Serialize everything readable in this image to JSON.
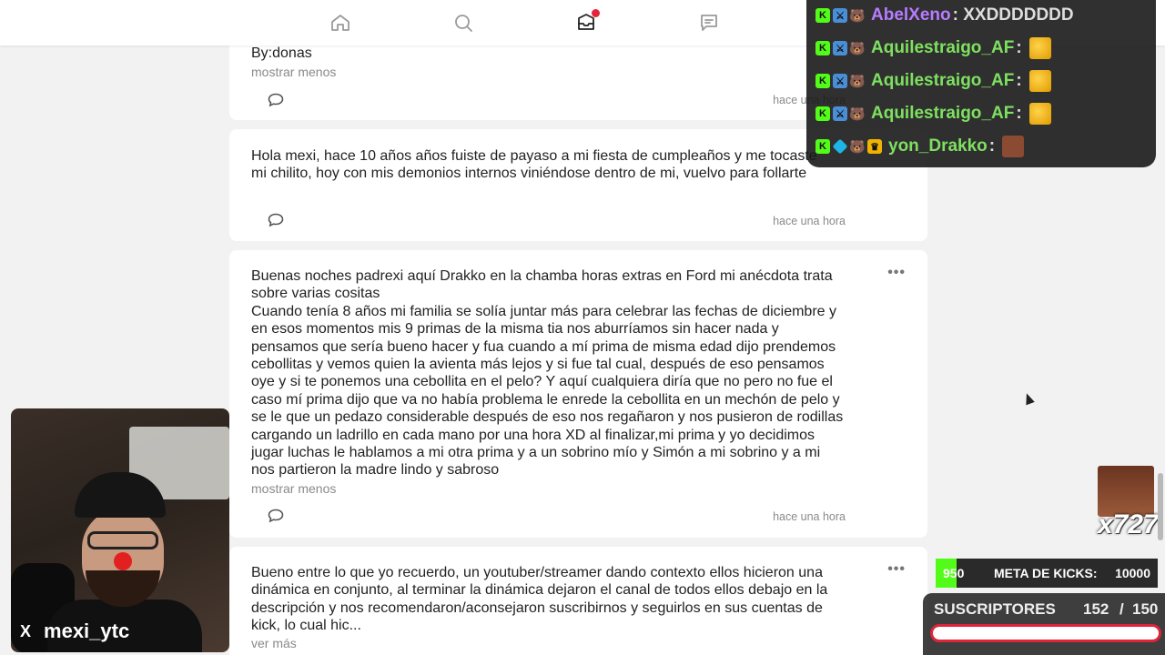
{
  "nav": {
    "icons": [
      "home-icon",
      "search-icon",
      "inbox-icon",
      "messages-icon"
    ]
  },
  "posts": [
    {
      "text": "By:donas",
      "toggle": "mostrar menos",
      "time": "hace una hora"
    },
    {
      "text": "Hola mexi, hace 10 años años fuiste de payaso a mi fiesta de cumpleaños y me tocaste mi chilito, hoy con mis demonios internos viniéndose dentro de mi, vuelvo para follarte",
      "time": "hace una hora"
    },
    {
      "text": "Buenas noches padrexi aquí Drakko en la chamba horas extras en Ford mi anécdota trata sobre varias cositas\nCuando tenía 8 años mi familia se solía juntar más para celebrar las fechas de diciembre y en esos momentos mis 9 primas de la misma tia nos aburríamos sin hacer nada y pensamos que sería bueno hacer y fua cuando a mí prima de misma edad dijo prendemos cebollitas y vemos quien la avienta más lejos y si fue tal cual, después de eso pensamos oye y si te ponemos una cebollita en el pelo? Y aquí cualquiera diría que no pero no fue el caso mí prima dijo que va no había problema le enrede la cebollita en un mechón de pelo y se le que un pedazo considerable después de eso nos regañaron y nos pusieron de rodillas cargando un ladrillo en cada mano por una hora XD al finalizar,mi prima y yo decidimos jugar luchas le hablamos a mi otra prima y a un sobrino mío y Simón a mi sobrino y a mi nos partieron la madre lindo y sabroso",
      "toggle": "mostrar menos",
      "time": "hace una hora",
      "more": "•••"
    },
    {
      "text": "Bueno entre lo que yo recuerdo, un youtuber/streamer dando contexto ellos hicieron una dinámica en conjunto, al terminar la dinámica dejaron el canal de todos ellos debajo en la descripción y nos recomendaron/aconsejaron suscribirnos y seguirlos en sus cuentas de kick, lo cual hic...",
      "toggle": "ver más",
      "more": "•••"
    }
  ],
  "chat": [
    {
      "user": "AbelXeno",
      "msg": ": XXDDDDDDD",
      "color": "#b67cff"
    },
    {
      "user": "Aquilestraigo_AF",
      "msg": ":",
      "color": "#7ee060"
    },
    {
      "user": "Aquilestraigo_AF",
      "msg": ":",
      "color": "#7ee060"
    },
    {
      "user": "Aquilestraigo_AF",
      "msg": ":",
      "color": "#7ee060"
    },
    {
      "user": "yon_Drakko",
      "msg": ":",
      "color": "#7ee060"
    }
  ],
  "webcam": {
    "handle": "mexi_ytc",
    "x_label": "X"
  },
  "widgets": {
    "kicks_multiplier": "x727",
    "kicks_current": "950",
    "kicks_label": "META DE KICKS:",
    "kicks_goal": "10000",
    "kicks_progress": 0.095,
    "subs_label": "SUSCRIPTORES",
    "subs_current": "152",
    "subs_sep": "/",
    "subs_goal": "150"
  },
  "colors": {
    "kick_green": "#53fc18",
    "notification_red": "#e5243b",
    "subs_bar_border": "#e0243a"
  }
}
